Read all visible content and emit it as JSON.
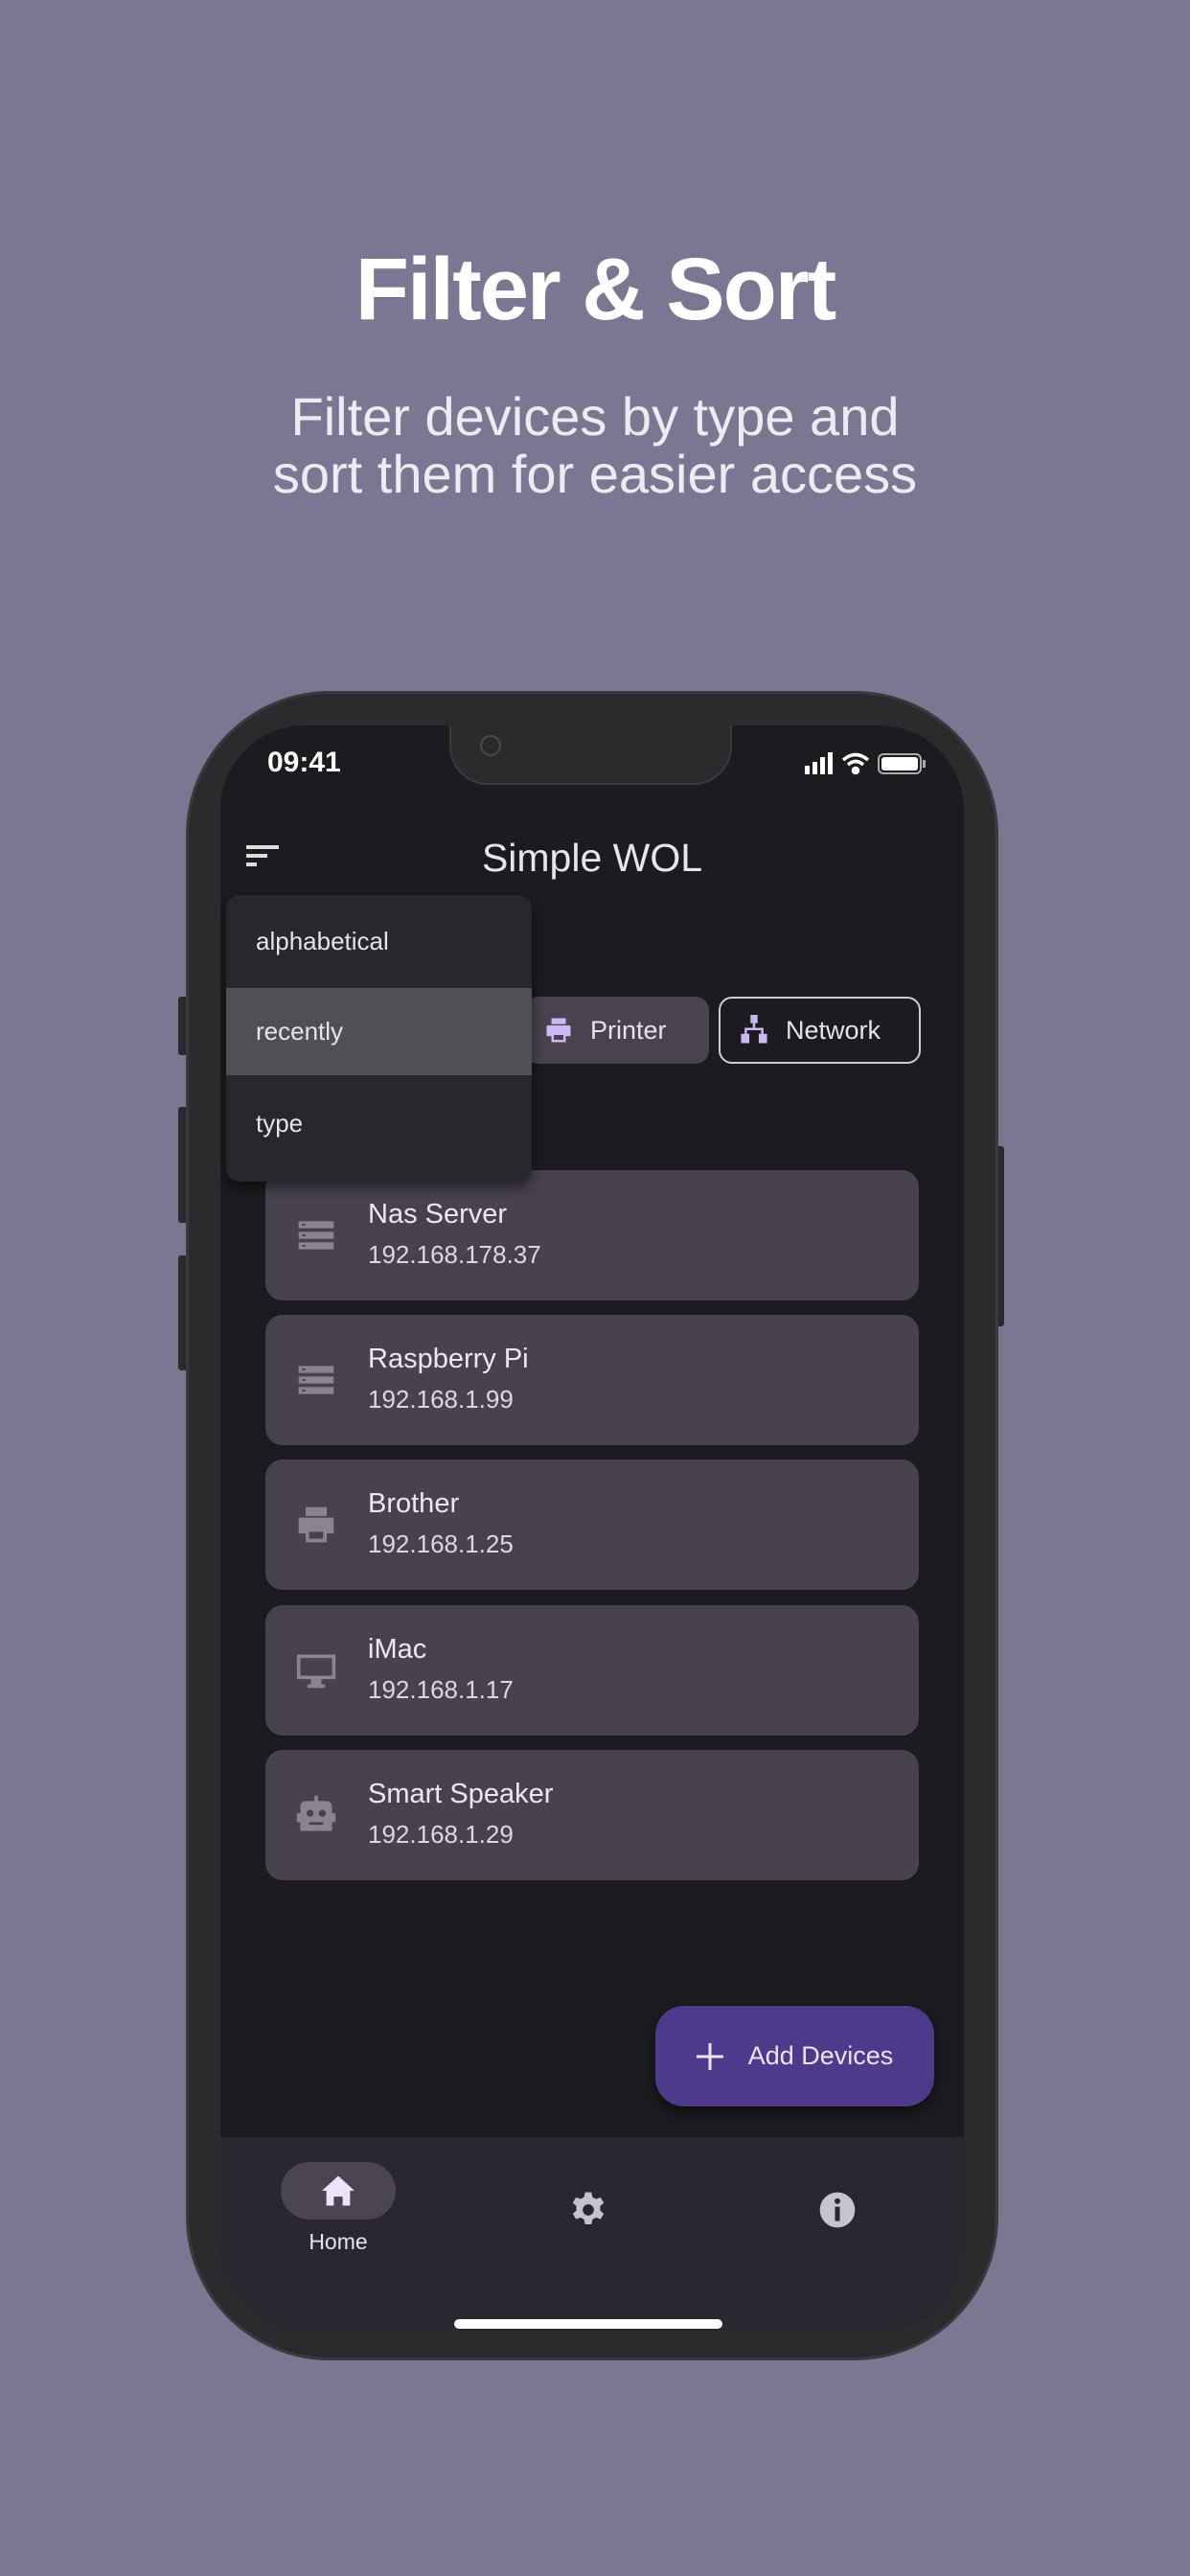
{
  "headline": "Filter & Sort",
  "subtitle_lines": [
    "Filter devices by type and",
    "sort them for easier access"
  ],
  "status_bar": {
    "time": "09:41"
  },
  "app": {
    "title": "Simple WOL"
  },
  "sort_menu": {
    "items": [
      "alphabetical",
      "recently",
      "type"
    ],
    "selected": "recently"
  },
  "filter_chips": [
    {
      "label": "Printer",
      "icon": "printer-icon",
      "selected": false
    },
    {
      "label": "Network",
      "icon": "network-icon",
      "selected": true
    }
  ],
  "devices": [
    {
      "name": "Nas Server",
      "ip": "192.168.178.37",
      "icon": "server-icon"
    },
    {
      "name": "Raspberry Pi",
      "ip": "192.168.1.99",
      "icon": "server-icon"
    },
    {
      "name": "Brother",
      "ip": "192.168.1.25",
      "icon": "printer-icon"
    },
    {
      "name": "iMac",
      "ip": "192.168.1.17",
      "icon": "desktop-icon"
    },
    {
      "name": "Smart Speaker",
      "ip": "192.168.1.29",
      "icon": "robot-icon"
    }
  ],
  "fab": {
    "label": "Add Devices"
  },
  "bottom_nav": [
    {
      "label": "Home",
      "icon": "home-icon",
      "active": true
    },
    {
      "label": "",
      "icon": "gear-icon"
    },
    {
      "label": "",
      "icon": "info-icon"
    }
  ],
  "colors": {
    "background": "#7b7792",
    "screen": "#1c1b1f",
    "card": "#48424f",
    "accent": "#4e3a8b",
    "chip_icon": "#cbb8f5"
  }
}
